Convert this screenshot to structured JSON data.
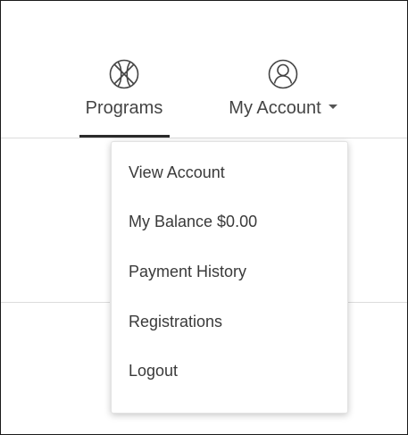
{
  "nav": {
    "programs": {
      "label": "Programs",
      "icon": "basketball-icon",
      "active": true
    },
    "account": {
      "label": "My Account",
      "icon": "user-circle-icon",
      "caret": "chevron-down-icon"
    }
  },
  "account_menu": {
    "items": [
      {
        "label": "View Account"
      },
      {
        "label": "My Balance $0.00"
      },
      {
        "label": "Payment History"
      },
      {
        "label": "Registrations"
      },
      {
        "label": "Logout"
      }
    ]
  },
  "colors": {
    "text": "#444444",
    "active_underline": "#2b2b2b",
    "menu_border": "#e2e2e2"
  }
}
